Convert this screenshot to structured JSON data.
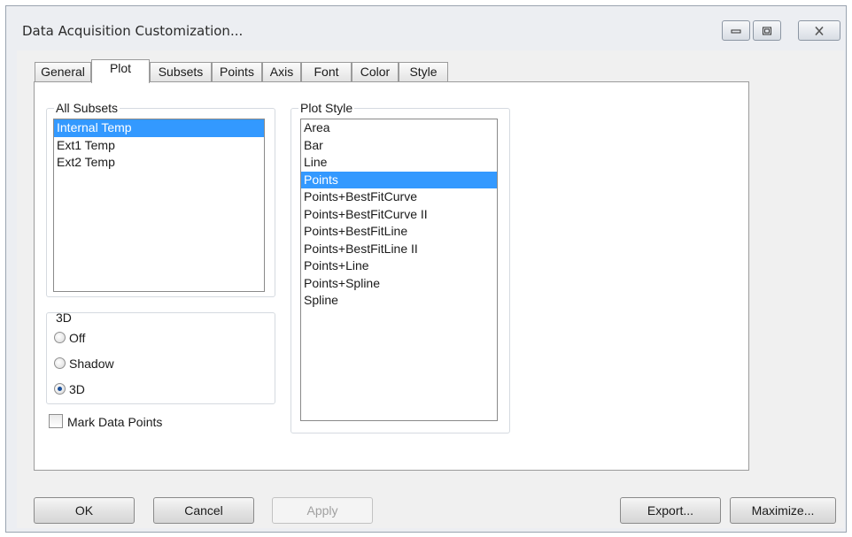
{
  "window": {
    "title": "Data Acquisition Customization..."
  },
  "tabs": [
    {
      "label": "General"
    },
    {
      "label": "Plot"
    },
    {
      "label": "Subsets"
    },
    {
      "label": "Points"
    },
    {
      "label": "Axis"
    },
    {
      "label": "Font"
    },
    {
      "label": "Color"
    },
    {
      "label": "Style"
    }
  ],
  "active_tab": "Plot",
  "all_subsets": {
    "label": "All Subsets",
    "items": [
      "Internal Temp",
      "Ext1 Temp",
      "Ext2 Temp"
    ],
    "selected": "Internal Temp"
  },
  "three_d": {
    "label": "3D",
    "options": [
      "Off",
      "Shadow",
      "3D"
    ],
    "selected": "3D"
  },
  "mark_data_points": {
    "label": "Mark Data Points",
    "checked": false
  },
  "plot_style": {
    "label": "Plot Style",
    "items": [
      "Area",
      "Bar",
      "Line",
      "Points",
      "Points+BestFitCurve",
      "Points+BestFitCurve II",
      "Points+BestFitLine",
      "Points+BestFitLine II",
      "Points+Line",
      "Points+Spline",
      "Spline"
    ],
    "selected": "Points"
  },
  "buttons": {
    "ok": "OK",
    "cancel": "Cancel",
    "apply": "Apply",
    "export": "Export...",
    "maximize": "Maximize..."
  },
  "colors": {
    "selection": "#3399ff",
    "window_frame": "#eceef2"
  }
}
